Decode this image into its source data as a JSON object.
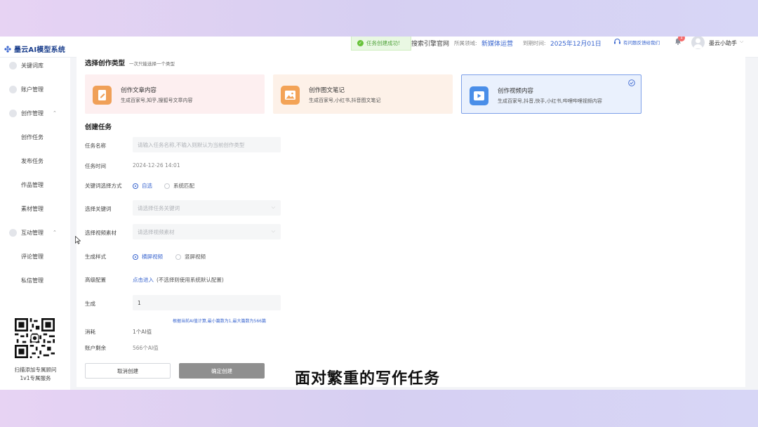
{
  "brand": {
    "name": "墨云AI模型系统"
  },
  "toast": {
    "text": "任务创建成功!"
  },
  "header": {
    "site": "搜索引擎官网",
    "field_label": "所属领域:",
    "field_value": "新媒体运营",
    "expire_label": "到期时间:",
    "expire_value": "2025年12月01日",
    "help": "有问题反馈给我们",
    "bell_count": "1",
    "user_name": "墨云小助手"
  },
  "sidebar": {
    "items": [
      {
        "label": "关键词库"
      },
      {
        "label": "账户管理"
      },
      {
        "label": "创作管理"
      },
      {
        "label": "创作任务"
      },
      {
        "label": "发布任务"
      },
      {
        "label": "作品管理"
      },
      {
        "label": "素材管理"
      },
      {
        "label": "互动管理"
      },
      {
        "label": "评论管理"
      },
      {
        "label": "私信管理"
      }
    ],
    "qr_line1": "扫描添加专属顾问",
    "qr_line2": "1v1专属服务"
  },
  "main": {
    "type_section_title": "选择创作类型",
    "type_section_hint": "一次只能选择一个类型",
    "types": [
      {
        "title": "创作文章内容",
        "desc": "生成百家号,知乎,搜狐号文章内容"
      },
      {
        "title": "创作图文笔记",
        "desc": "生成百家号,小红书,抖音图文笔记"
      },
      {
        "title": "创作视频内容",
        "desc": "生成百家号,抖音,快手,小红书,哔哩哔哩视频内容"
      }
    ],
    "task_section_title": "创建任务",
    "form": {
      "name_label": "任务名称",
      "name_placeholder": "请输入任务名称,不输入则默认为当前创作类型",
      "time_label": "任务时间",
      "time_value": "2024-12-26 14:01",
      "kw_mode_label": "关键词选择方式",
      "kw_mode_opt1": "自选",
      "kw_mode_opt2": "系统匹配",
      "kw_label": "选择关键词",
      "kw_placeholder": "请选择任务关键词",
      "material_label": "选择视频素材",
      "material_placeholder": "请选择视频素材",
      "style_label": "生成样式",
      "style_opt1": "横屏视频",
      "style_opt2": "竖屏视频",
      "adv_label": "高级配置",
      "adv_link": "点击进入",
      "adv_note": "(不选择则使用系统默认配置)",
      "gen_label": "生成",
      "gen_value": "1",
      "calc_note": "根据当前AI值计算,最小篇数为1,最大篇数为566篇",
      "cost_label": "消耗",
      "cost_value": "1个AI值",
      "balance_label": "账户剩余",
      "balance_value": "566个AI值",
      "cancel_label": "取消创建",
      "confirm_label": "确定创建"
    }
  },
  "caption": "面对繁重的写作任务"
}
